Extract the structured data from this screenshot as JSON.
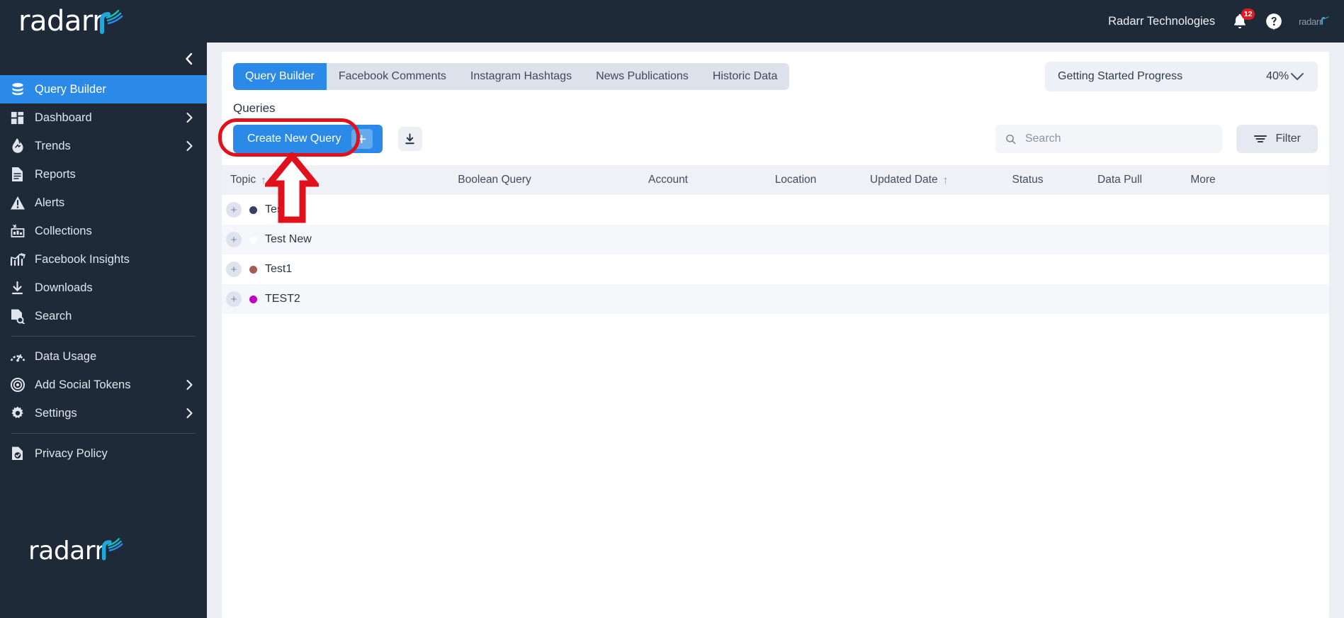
{
  "header": {
    "brand": "radarr",
    "org_name": "Radarr Technologies",
    "notification_count": "12",
    "bell_icon": "bell-icon",
    "help_icon": "help-circle-icon",
    "mini_logo": "radarr"
  },
  "sidebar": {
    "collapse_icon": "chevron-left-icon",
    "footer_logo": "radarr",
    "items": [
      {
        "label": "Query Builder",
        "icon": "database-icon",
        "active": true,
        "chevron": false,
        "divider_after": false
      },
      {
        "label": "Dashboard",
        "icon": "grid-icon",
        "active": false,
        "chevron": true,
        "divider_after": false
      },
      {
        "label": "Trends",
        "icon": "fire-icon",
        "active": false,
        "chevron": true,
        "divider_after": false
      },
      {
        "label": "Reports",
        "icon": "document-icon",
        "active": false,
        "chevron": false,
        "divider_after": false
      },
      {
        "label": "Alerts",
        "icon": "warning-icon",
        "active": false,
        "chevron": false,
        "divider_after": false
      },
      {
        "label": "Collections",
        "icon": "collections-icon",
        "active": false,
        "chevron": false,
        "divider_after": false
      },
      {
        "label": "Facebook Insights",
        "icon": "chart-line-icon",
        "active": false,
        "chevron": false,
        "divider_after": false
      },
      {
        "label": "Downloads",
        "icon": "download-icon",
        "active": false,
        "chevron": false,
        "divider_after": false
      },
      {
        "label": "Search",
        "icon": "file-search-icon",
        "active": false,
        "chevron": false,
        "divider_after": true
      },
      {
        "label": "Data Usage",
        "icon": "gauge-icon",
        "active": false,
        "chevron": false,
        "divider_after": false
      },
      {
        "label": "Add Social Tokens",
        "icon": "target-icon",
        "active": false,
        "chevron": true,
        "divider_after": false
      },
      {
        "label": "Settings",
        "icon": "gear-icon",
        "active": false,
        "chevron": true,
        "divider_after": true
      },
      {
        "label": "Privacy Policy",
        "icon": "shield-doc-icon",
        "active": false,
        "chevron": false,
        "divider_after": false
      }
    ]
  },
  "tabs": [
    {
      "label": "Query Builder",
      "active": true
    },
    {
      "label": "Facebook Comments",
      "active": false
    },
    {
      "label": "Instagram Hashtags",
      "active": false
    },
    {
      "label": "News Publications",
      "active": false
    },
    {
      "label": "Historic Data",
      "active": false
    }
  ],
  "progress": {
    "label": "Getting Started Progress",
    "percent": "40%",
    "chevron_icon": "chevron-down-icon"
  },
  "main": {
    "section_title": "Queries",
    "create_button": "Create New Query",
    "create_plus_icon": "plus-icon",
    "download_icon": "download-icon",
    "search": {
      "value": "",
      "placeholder": "Search",
      "icon": "search-icon"
    },
    "filter": {
      "label": "Filter",
      "icon": "filter-icon"
    }
  },
  "table": {
    "columns": [
      {
        "label": "Topic",
        "sort": "↑"
      },
      {
        "label": "Boolean Query",
        "sort": ""
      },
      {
        "label": "Account",
        "sort": ""
      },
      {
        "label": "Location",
        "sort": ""
      },
      {
        "label": "Updated Date",
        "sort": "↑"
      },
      {
        "label": "Status",
        "sort": ""
      },
      {
        "label": "Data Pull",
        "sort": ""
      },
      {
        "label": "More",
        "sort": ""
      }
    ],
    "expand_icon": "plus-icon",
    "rows": [
      {
        "topic": "Test",
        "dot_color": "#3b3f68",
        "boolean_query": "",
        "account": "",
        "location": "",
        "updated_date": "",
        "status": "",
        "data_pull": "",
        "more": ""
      },
      {
        "topic": "Test New",
        "dot_color": "#fdfdfd",
        "boolean_query": "",
        "account": "",
        "location": "",
        "updated_date": "",
        "status": "",
        "data_pull": "",
        "more": ""
      },
      {
        "topic": "Test1",
        "dot_color": "#a85a56",
        "boolean_query": "",
        "account": "",
        "location": "",
        "updated_date": "",
        "status": "",
        "data_pull": "",
        "more": ""
      },
      {
        "topic": "TEST2",
        "dot_color": "#c200c2",
        "boolean_query": "",
        "account": "",
        "location": "",
        "updated_date": "",
        "status": "",
        "data_pull": "",
        "more": ""
      }
    ]
  },
  "annotations": {
    "highlight_color": "#e1111c",
    "highlight_target": "create-new-query-button",
    "arrow_direction": "up"
  },
  "colors": {
    "accent_blue": "#2b8ae8",
    "sidebar_bg": "#1e2a38",
    "page_bg": "#eceef4",
    "annotation_red": "#e1111c"
  }
}
